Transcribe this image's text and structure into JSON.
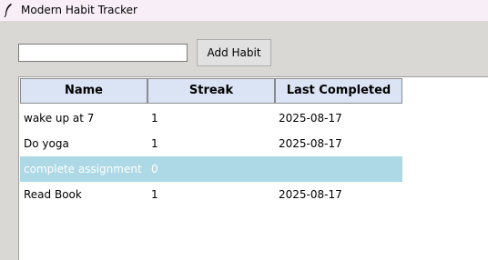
{
  "window": {
    "title": "Modern Habit Tracker",
    "icon": "feather-icon"
  },
  "form": {
    "input_value": "",
    "add_button_label": "Add Habit"
  },
  "table": {
    "columns": [
      "Name",
      "Streak",
      "Last Completed"
    ],
    "rows": [
      {
        "name": "wake up at 7",
        "streak": "1",
        "last": "2025-08-17",
        "selected": false
      },
      {
        "name": "Do yoga",
        "streak": "1",
        "last": "2025-08-17",
        "selected": false
      },
      {
        "name": "complete assignment",
        "streak": "0",
        "last": "",
        "selected": true
      },
      {
        "name": "Read Book",
        "streak": "1",
        "last": "2025-08-17",
        "selected": false
      }
    ],
    "selection_color": "#add8e6",
    "header_color": "#dbe4f4"
  }
}
